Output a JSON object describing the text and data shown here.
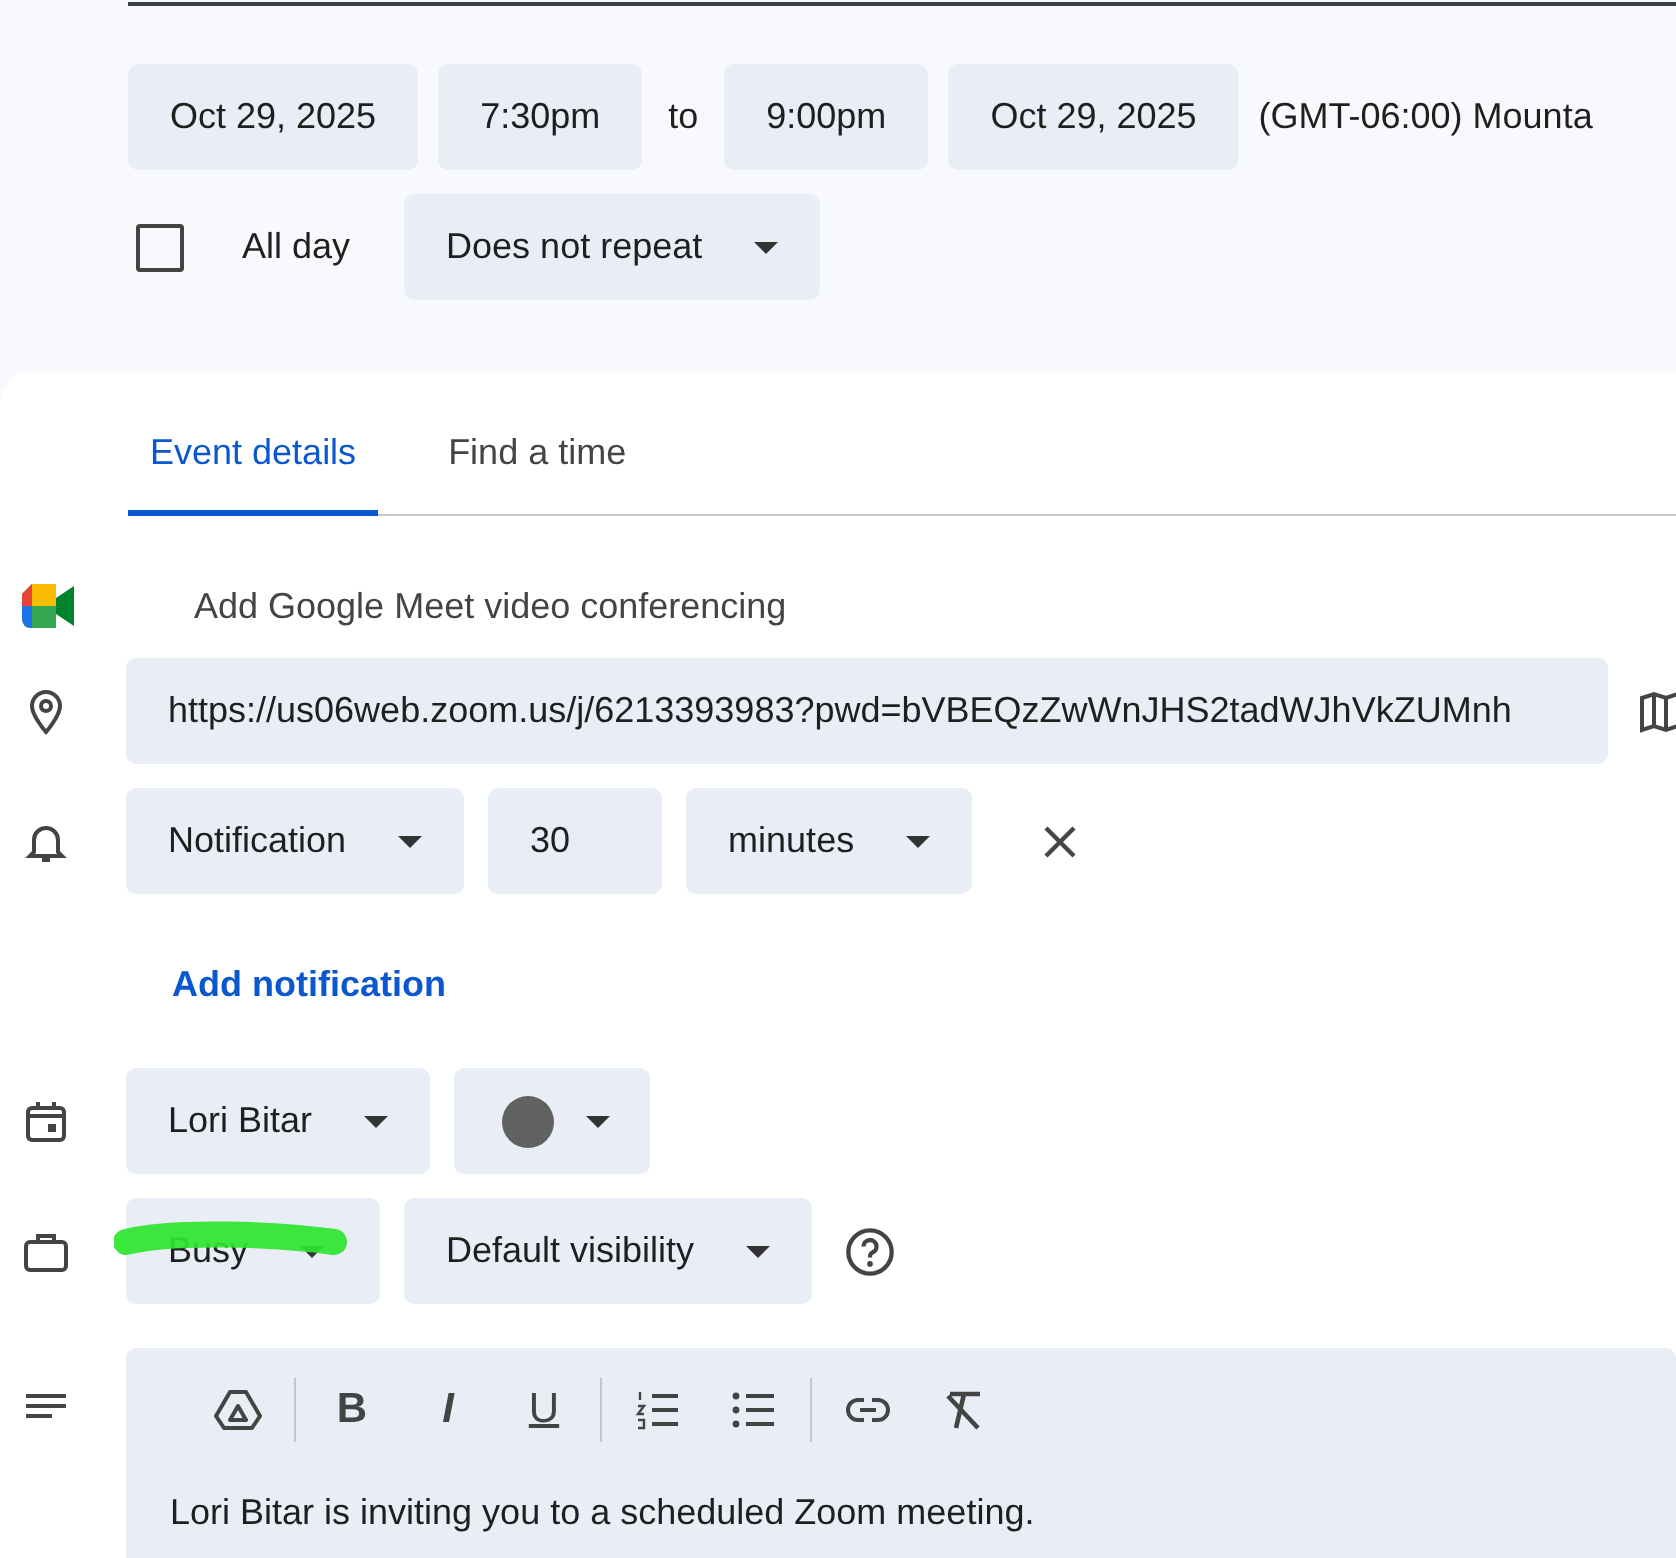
{
  "date_row": {
    "start_date": "Oct 29, 2025",
    "start_time": "7:30pm",
    "separator": "to",
    "end_time": "9:00pm",
    "end_date": "Oct 29, 2025",
    "timezone": "(GMT-06:00) Mounta"
  },
  "all_day": {
    "label": "All day",
    "checked": false
  },
  "repeat": {
    "value": "Does not repeat"
  },
  "tabs": [
    {
      "label": "Event details",
      "selected": true
    },
    {
      "label": "Find a time",
      "selected": false
    }
  ],
  "conferencing": {
    "label": "Add Google Meet video conferencing"
  },
  "location": {
    "value": "https://us06web.zoom.us/j/6213393983?pwd=bVBEQzZwWnJHS2tadWJhVkZUMnh"
  },
  "notification": {
    "type": "Notification",
    "amount": "30",
    "unit": "minutes"
  },
  "add_notification": "Add notification",
  "calendar": {
    "owner": "Lori Bitar",
    "color": "#616161"
  },
  "availability": {
    "status": "Busy",
    "highlighted": true,
    "visibility": "Default visibility"
  },
  "toolbar": [
    {
      "kind": "drive"
    },
    {
      "kind": "sep"
    },
    {
      "kind": "bold",
      "text": "B"
    },
    {
      "kind": "italic",
      "text": "I"
    },
    {
      "kind": "underline",
      "text": "U"
    },
    {
      "kind": "sep"
    },
    {
      "kind": "numbered"
    },
    {
      "kind": "bulleted"
    },
    {
      "kind": "sep"
    },
    {
      "kind": "link"
    },
    {
      "kind": "clear"
    }
  ],
  "description": "Lori Bitar is inviting you to a scheduled Zoom meeting."
}
